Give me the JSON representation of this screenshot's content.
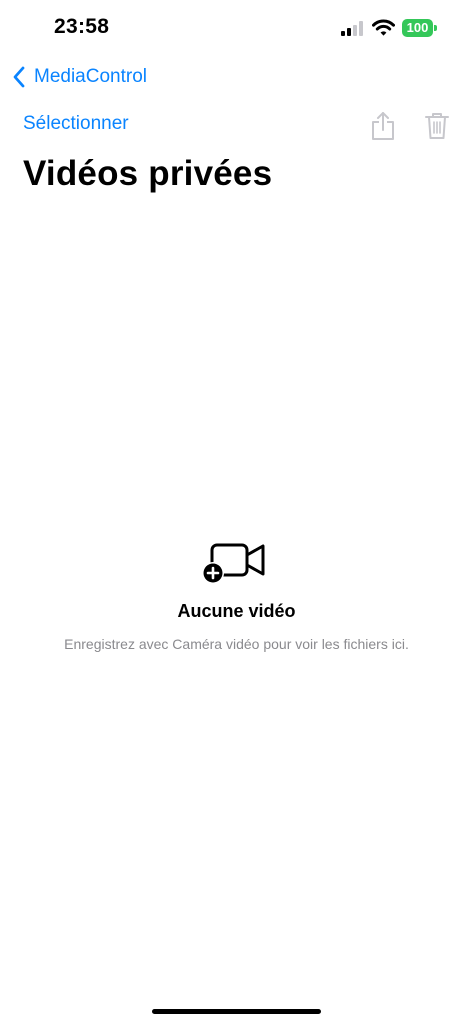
{
  "status_bar": {
    "time": "23:58",
    "battery": "100",
    "battery_color": "#34c759",
    "icons": [
      "signal-icon",
      "wifi-icon",
      "battery-icon"
    ]
  },
  "nav": {
    "back_label": "MediaControl",
    "select_label": "Sélectionner",
    "accent_color": "#0a84ff",
    "actions": [
      "share-icon",
      "trash-icon"
    ]
  },
  "page": {
    "title": "Vidéos privées"
  },
  "empty_state": {
    "icon": "video-add-icon",
    "title": "Aucune vidéo",
    "subtitle": "Enregistrez avec Caméra vidéo pour voir les fichiers ici."
  }
}
